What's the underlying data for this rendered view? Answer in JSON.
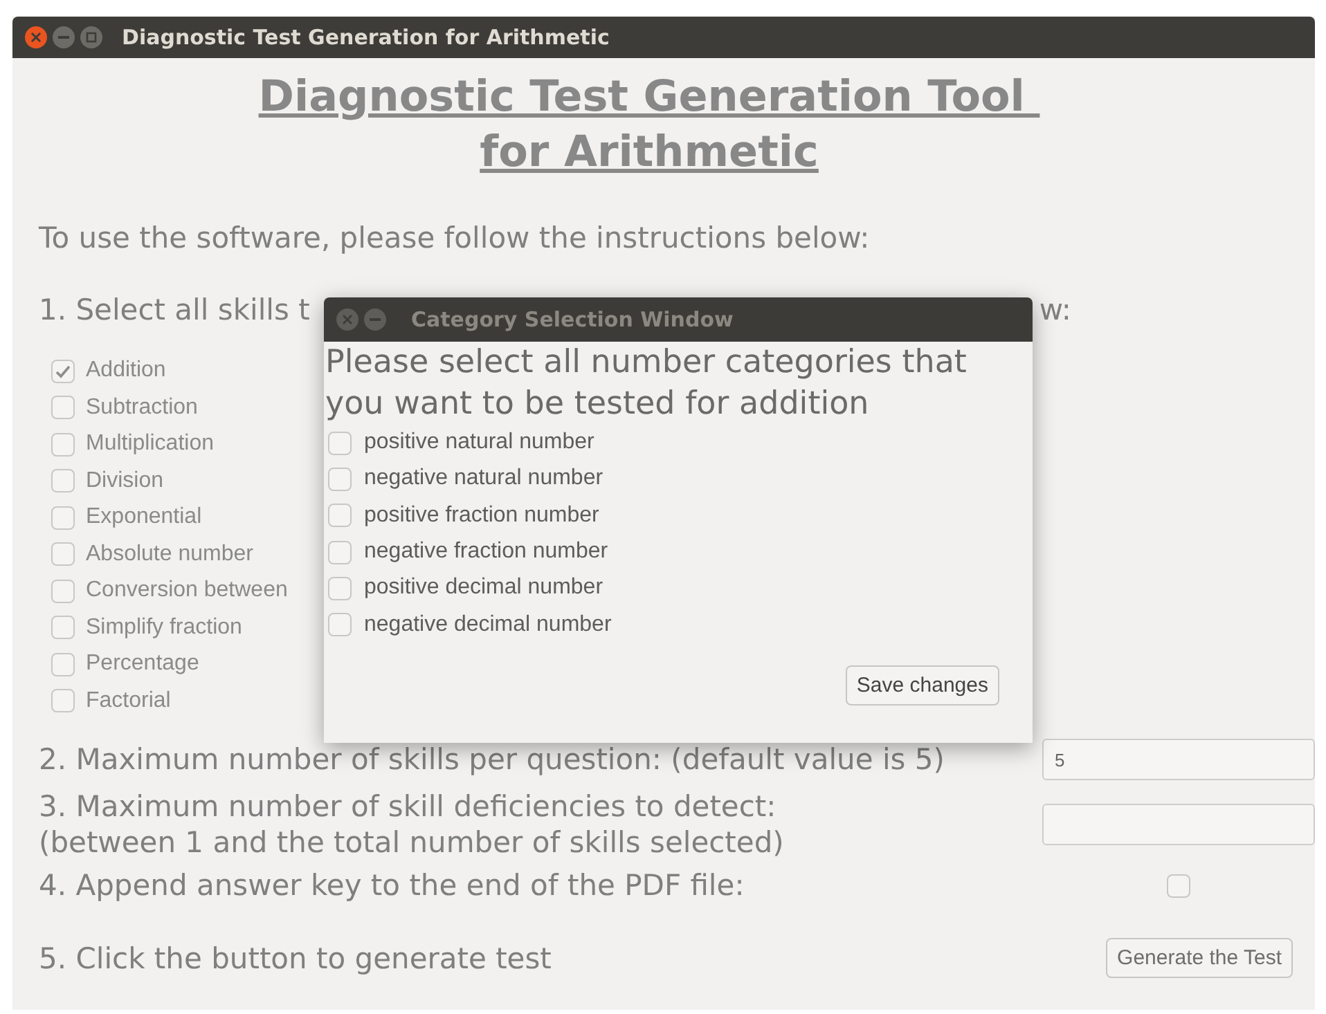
{
  "window": {
    "title": "Diagnostic Test Generation for Arithmetic"
  },
  "heading": {
    "lines": [
      "Diagnostic Test Generation Tool ",
      "for Arithmetic"
    ]
  },
  "instructions": "To use the software, please follow the instructions below:",
  "step_1": {
    "text_start": "1. Select all skills t",
    "text_end": "w:"
  },
  "skills": [
    {
      "label": "Addition",
      "checked": true
    },
    {
      "label": "Subtraction",
      "checked": false
    },
    {
      "label": "Multiplication",
      "checked": false
    },
    {
      "label": "Division",
      "checked": false
    },
    {
      "label": "Exponential",
      "checked": false
    },
    {
      "label": "Absolute number",
      "checked": false
    },
    {
      "label": "Conversion between",
      "checked": false
    },
    {
      "label": "Simplify fraction",
      "checked": false
    },
    {
      "label": "Percentage",
      "checked": false
    },
    {
      "label": "Factorial",
      "checked": false
    }
  ],
  "step_2": {
    "label": "2. Maximum number of skills per question: (default value is 5)",
    "value": "5"
  },
  "step_3": {
    "lines": [
      "3. Maximum number of skill deficiencies to detect:",
      "(between 1 and the total number of skills selected)"
    ]
  },
  "step_4": {
    "label": "4. Append answer key to the end of the PDF file:",
    "checked": false
  },
  "step_5": {
    "label": "5. Click the button to generate test",
    "button": "Generate the Test"
  },
  "dialog": {
    "title": "Category Selection Window",
    "prompt": "Please select all number categories that you want to be tested for addition",
    "categories": [
      {
        "label": "positive natural number",
        "checked": false
      },
      {
        "label": "negative natural number",
        "checked": false
      },
      {
        "label": "positive fraction number",
        "checked": false
      },
      {
        "label": "negative fraction number",
        "checked": false
      },
      {
        "label": "positive decimal number",
        "checked": false
      },
      {
        "label": "negative decimal number",
        "checked": false
      }
    ],
    "button": "Save changes"
  }
}
